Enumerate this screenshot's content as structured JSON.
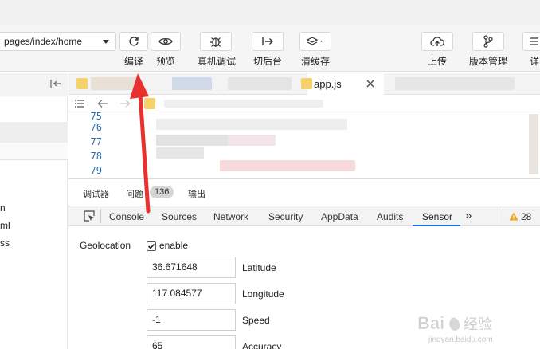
{
  "toolbar": {
    "page_path": "pages/index/home",
    "buttons": [
      {
        "label": "编译",
        "icon": "refresh-icon"
      },
      {
        "label": "预览",
        "icon": "eye-icon"
      },
      {
        "label": "真机调试",
        "icon": "bug-icon"
      },
      {
        "label": "切后台",
        "icon": "switch-background-icon"
      },
      {
        "label": "清缓存",
        "icon": "layers-icon"
      },
      {
        "label": "上传",
        "icon": "cloud-upload-icon"
      },
      {
        "label": "版本管理",
        "icon": "branch-icon"
      },
      {
        "label": "详",
        "icon": "menu-icon"
      }
    ]
  },
  "left_pane": {
    "files": [
      "n",
      "ml",
      "ss"
    ]
  },
  "editor": {
    "active_tab": "app.js",
    "line_numbers": [
      "75",
      "76",
      "77",
      "78",
      "79"
    ]
  },
  "devtools": {
    "header_tabs": [
      {
        "label": "调试器"
      },
      {
        "label": "问题",
        "badge": "136"
      },
      {
        "label": "输出"
      }
    ],
    "panel_tabs": [
      "Console",
      "Sources",
      "Network",
      "Security",
      "AppData",
      "Audits",
      "Sensor"
    ],
    "active_panel": "Sensor",
    "more_label": "»",
    "warning_count": "28"
  },
  "sensor": {
    "geolocation_label": "Geolocation",
    "enable_label": "enable",
    "enable_checked": true,
    "fields": [
      {
        "value": "36.671648",
        "label": "Latitude"
      },
      {
        "value": "117.084577",
        "label": "Longitude"
      },
      {
        "value": "-1",
        "label": "Speed"
      },
      {
        "value": "65",
        "label": "Accuracy"
      }
    ]
  },
  "watermark": {
    "brand": "Bai",
    "brand_cn": "经验",
    "url": "jingyan.baidu.com"
  },
  "colors": {
    "accent": "#1a73e8",
    "line_number": "#2a6fb0",
    "annotation_arrow": "#e8312f",
    "warning": "#e8a317"
  }
}
